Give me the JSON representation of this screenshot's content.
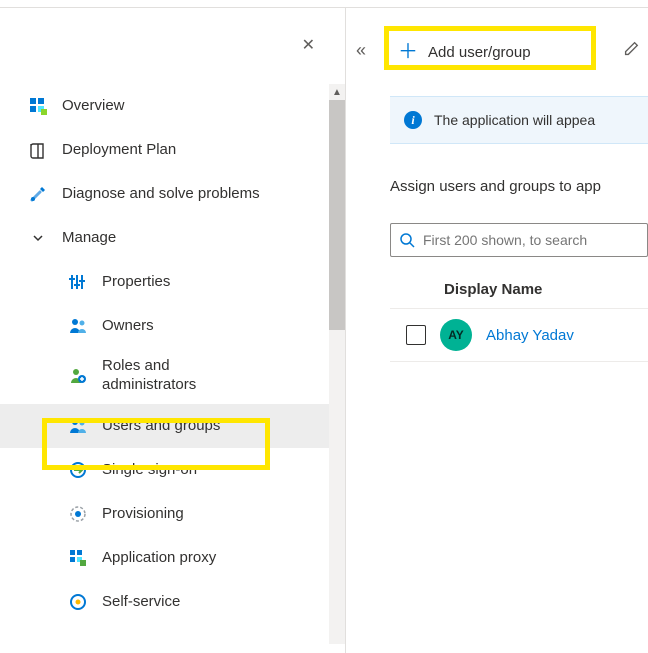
{
  "sidebar": {
    "items": [
      {
        "label": "Overview"
      },
      {
        "label": "Deployment Plan"
      },
      {
        "label": "Diagnose and solve problems"
      }
    ],
    "manage_label": "Manage",
    "manage_items": [
      {
        "label": "Properties"
      },
      {
        "label": "Owners"
      },
      {
        "label": "Roles and administrators"
      },
      {
        "label": "Users and groups"
      },
      {
        "label": "Single sign-on"
      },
      {
        "label": "Provisioning"
      },
      {
        "label": "Application proxy"
      },
      {
        "label": "Self-service"
      }
    ]
  },
  "cmdbar": {
    "add_label": "Add user/group"
  },
  "banner": {
    "text": "The application will appea"
  },
  "description": "Assign users and groups to app",
  "search": {
    "placeholder": "First 200 shown, to search"
  },
  "table": {
    "col1": "Display Name",
    "rows": [
      {
        "initials": "AY",
        "name": "Abhay Yadav"
      }
    ]
  }
}
